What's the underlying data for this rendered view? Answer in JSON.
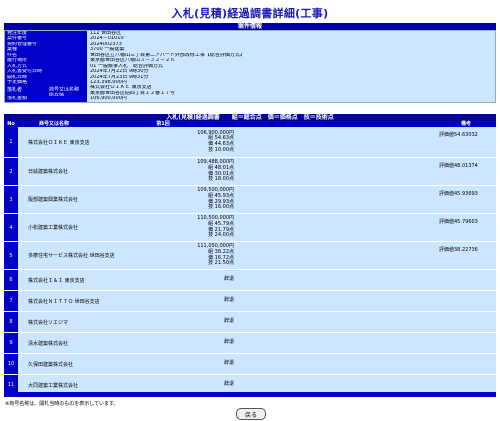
{
  "title": "入札(見積)経過調書詳細(工事)",
  "case_info": {
    "header": "案件情報",
    "rows": [
      {
        "label": "発注年度",
        "value": "112 世田谷区"
      },
      {
        "label": "案件番号",
        "value": "2024－01010"
      },
      {
        "label": "契約管理番号",
        "value": "2024002373"
      },
      {
        "label": "業種",
        "value": "3700 一般建築"
      },
      {
        "label": "件名",
        "value": "世田谷区立八幡山三丁目第二アパート外部改修工事【総合評価方式】"
      },
      {
        "label": "履行場所",
        "value": "東京都世田谷区八幡山３－３２－２６"
      },
      {
        "label": "入札方式",
        "value": "01 一般競争入札　総合評価方式"
      },
      {
        "label": "入札書受付日時",
        "value": "2024年7月22日 9時30分"
      },
      {
        "label": "開札日時",
        "value": "2024年7月23日 9時31分"
      },
      {
        "label": "予定価格",
        "value": "123,398,000円"
      }
    ],
    "winner": {
      "label": "落札者",
      "sub": [
        {
          "label": "商号又は名称",
          "value": "株式会社ＯＩＫＥ 東京支店"
        },
        {
          "label": "所在地",
          "value": "東京都世田谷区砧四丁目１２番１７号"
        }
      ]
    },
    "price": {
      "label": "落札金額",
      "value": "106,900,000円"
    }
  },
  "result": {
    "header": "入札(見積)経過調書　　組＝総合点　価＝価格点　技＝技術点",
    "columns": {
      "no": "No",
      "name": "商号又は名称",
      "amt": "第1回",
      "note": "備考"
    },
    "rows": [
      {
        "no": "1",
        "name": "株式会社ＯＩＫＥ 東京支店",
        "amt": [
          "106,900,000円",
          "組 54.63点",
          "価 44.63点",
          "技 10.00点"
        ],
        "note": "評価値54.63032"
      },
      {
        "no": "2",
        "name": "日絃建築株式会社",
        "amt": [
          "109,488,000円",
          "組 48.01点",
          "価 30.01点",
          "技 18.00点"
        ],
        "note": "評価値48.01374"
      },
      {
        "no": "3",
        "name": "阪部建築興業株式会社",
        "amt": [
          "109,500,000円",
          "組 45.93点",
          "価 29.93点",
          "技 16.00点"
        ],
        "note": "評価値45.93693"
      },
      {
        "no": "4",
        "name": "小松建築工業株式会社",
        "amt": [
          "110,500,000円",
          "組 45.79点",
          "価 21.79点",
          "技 24.00点"
        ],
        "note": "評価値45.79603"
      },
      {
        "no": "5",
        "name": "多摩住宅サービス株式会社 世田谷支店",
        "amt": [
          "111,050,000円",
          "組 38.22点",
          "価 16.72点",
          "技 21.50点"
        ],
        "note": "評価値38.22736"
      },
      {
        "no": "6",
        "name": "株式会社Ｉ＆Ｉ 東京支店",
        "amt": [
          "辞退"
        ],
        "note": ""
      },
      {
        "no": "7",
        "name": "株式会社ＮＩＴＴＯ 世田谷支店",
        "amt": [
          "辞退"
        ],
        "note": ""
      },
      {
        "no": "8",
        "name": "株式会社ソエジマ",
        "amt": [
          "辞退"
        ],
        "note": ""
      },
      {
        "no": "9",
        "name": "清水建築株式会社",
        "amt": [
          "辞退"
        ],
        "note": ""
      },
      {
        "no": "10",
        "name": "久保田建築株式会社",
        "amt": [
          "辞退"
        ],
        "note": ""
      },
      {
        "no": "11",
        "name": "大同建築工業株式会社",
        "amt": [
          "辞退"
        ],
        "note": ""
      }
    ]
  },
  "footnote": "※商号名称は、開札当時のものを表示しています。",
  "back_button": "戻る"
}
